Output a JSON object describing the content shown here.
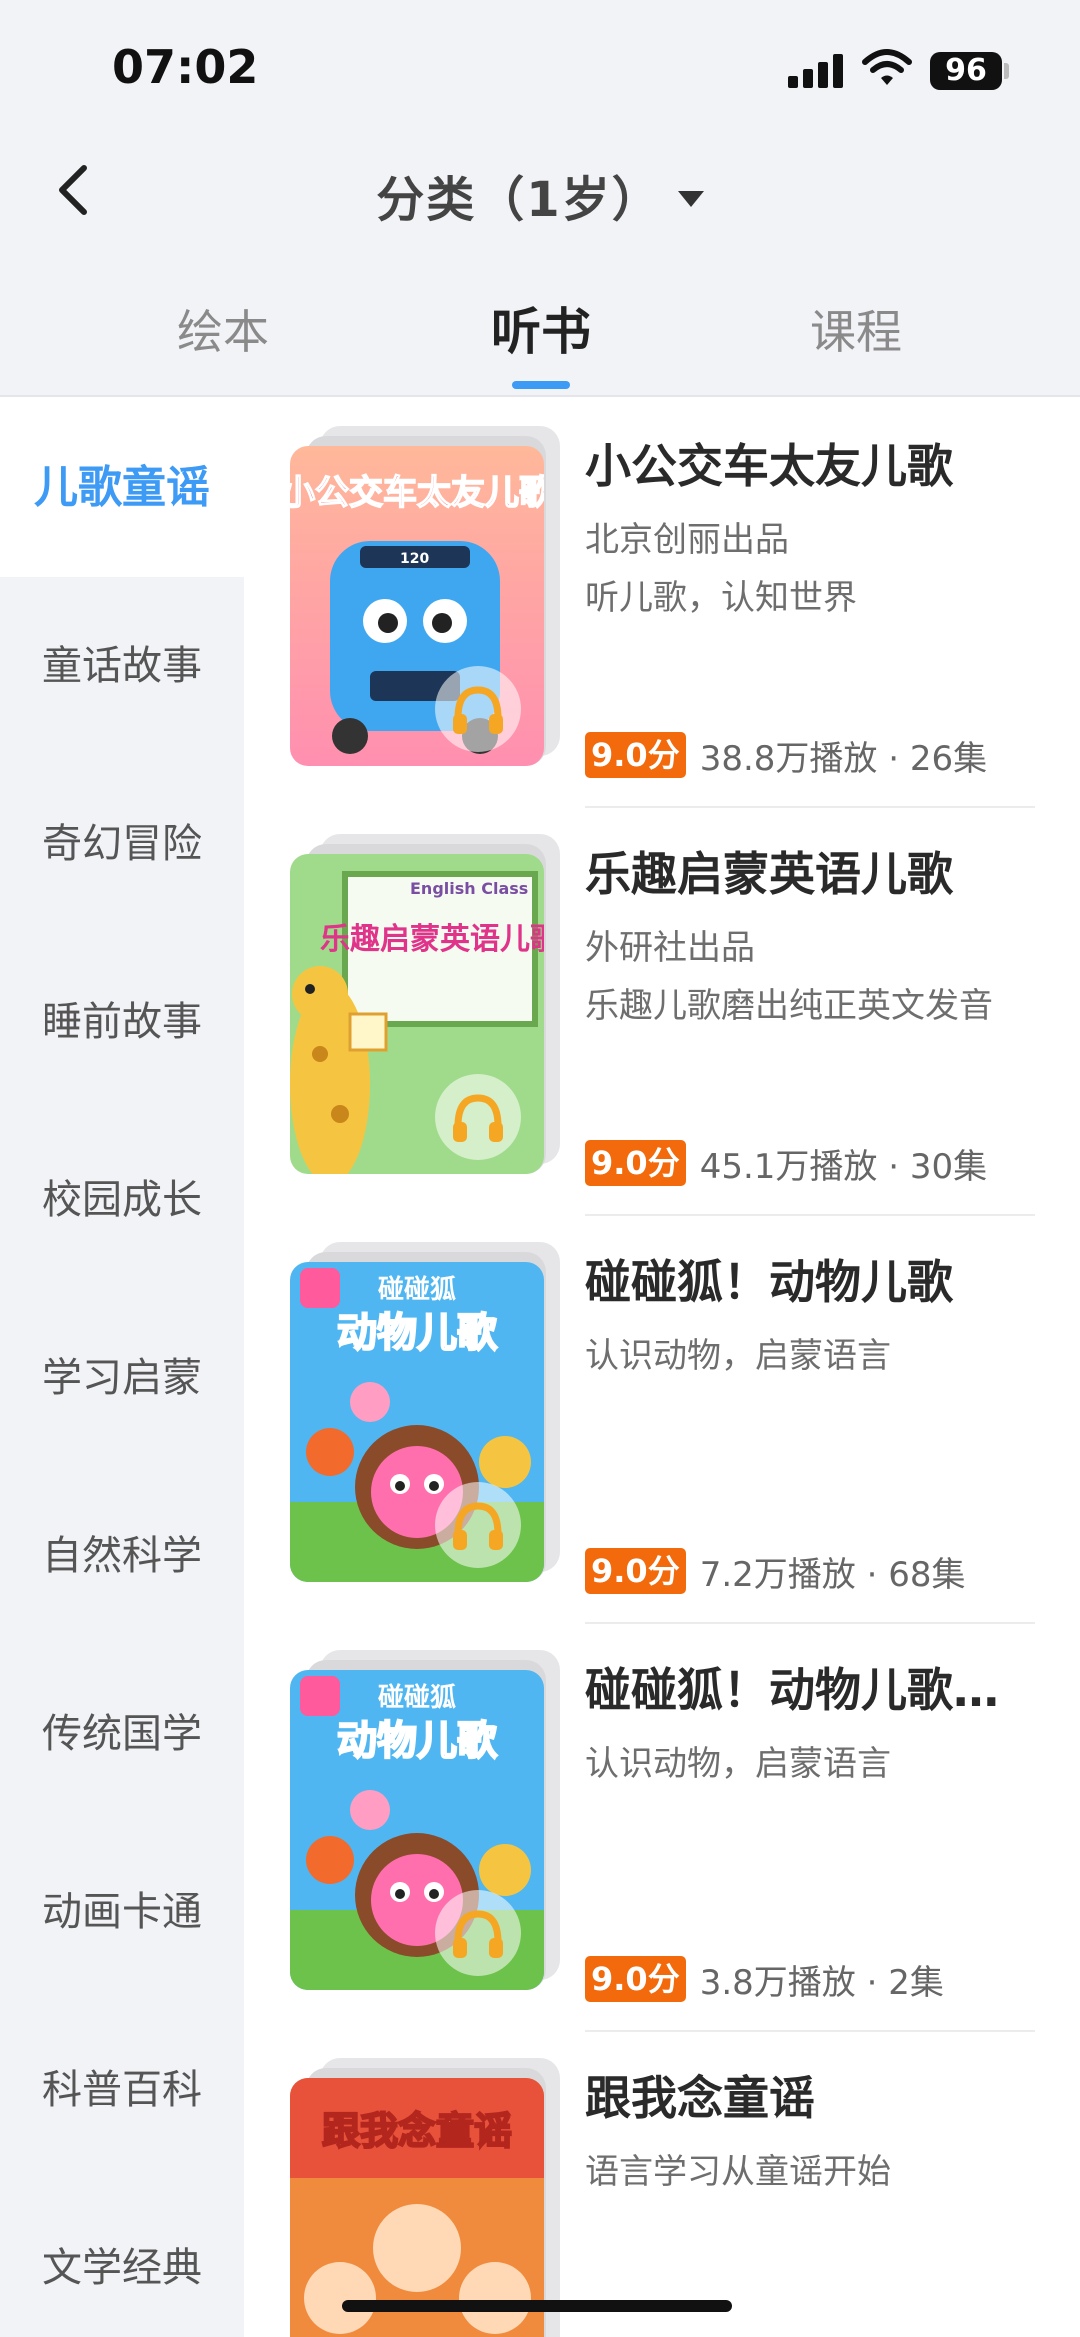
{
  "status": {
    "time": "07:02",
    "battery": "96"
  },
  "nav": {
    "title": "分类（1岁）"
  },
  "tabs": [
    {
      "label": "绘本"
    },
    {
      "label": "听书"
    },
    {
      "label": "课程"
    }
  ],
  "sidebar": {
    "items": [
      {
        "label": "儿歌童谣"
      },
      {
        "label": "童话故事"
      },
      {
        "label": "奇幻冒险"
      },
      {
        "label": "睡前故事"
      },
      {
        "label": "校园成长"
      },
      {
        "label": "学习启蒙"
      },
      {
        "label": "自然科学"
      },
      {
        "label": "传统国学"
      },
      {
        "label": "动画卡通"
      },
      {
        "label": "科普百科"
      },
      {
        "label": "文学经典"
      }
    ]
  },
  "list": [
    {
      "title": "小公交车太友儿歌",
      "publisher": "北京创丽出品",
      "desc": "听儿歌，认知世界",
      "score": "9.0分",
      "plays": "38.8万播放 · 26集",
      "cover_text": "小公交车太友儿歌",
      "cover_bus_number": "120"
    },
    {
      "title": "乐趣启蒙英语儿歌",
      "publisher": "外研社出品",
      "desc": "乐趣儿歌磨出纯正英文发音",
      "score": "9.0分",
      "plays": "45.1万播放 · 30集",
      "cover_text": "乐趣启蒙英语儿歌",
      "cover_small": "English Class"
    },
    {
      "title": "碰碰狐！动物儿歌",
      "desc": "认识动物，启蒙语言",
      "score": "9.0分",
      "plays": "7.2万播放 · 68集",
      "cover_text_1": "碰碰狐",
      "cover_text_2": "动物儿歌"
    },
    {
      "title": "碰碰狐！动物儿歌…",
      "desc": "认识动物，启蒙语言",
      "score": "9.0分",
      "plays": "3.8万播放 · 2集",
      "cover_text_1": "碰碰狐",
      "cover_text_2": "动物儿歌"
    },
    {
      "title": "跟我念童谣",
      "desc": "语言学习从童谣开始",
      "cover_text": "跟我念童谣"
    }
  ],
  "colors": {
    "accent": "#3d9af5",
    "score": "#f26a0b"
  },
  "icons": [
    "back-arrow-icon",
    "dropdown-caret-icon",
    "signal-icon",
    "wifi-icon",
    "battery-icon",
    "headphone-icon"
  ]
}
